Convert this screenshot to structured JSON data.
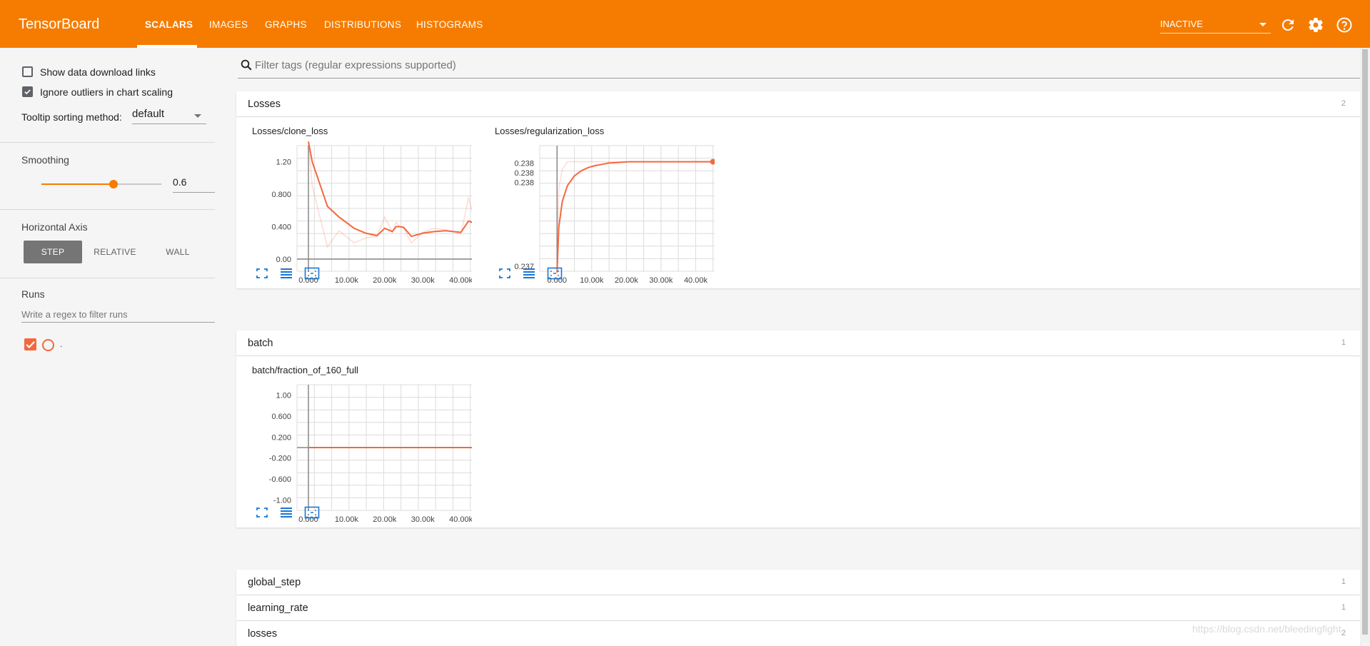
{
  "header": {
    "brand": "TensorBoard",
    "tabs": [
      "SCALARS",
      "IMAGES",
      "GRAPHS",
      "DISTRIBUTIONS",
      "HISTOGRAMS"
    ],
    "active_tab": "SCALARS",
    "run_status": "INACTIVE",
    "icons": [
      "refresh-icon",
      "settings-icon",
      "help-icon"
    ]
  },
  "sidebar": {
    "show_download_label": "Show data download links",
    "show_download_checked": false,
    "ignore_outliers_label": "Ignore outliers in chart scaling",
    "ignore_outliers_checked": true,
    "tooltip_label": "Tooltip sorting method:",
    "tooltip_value": "default",
    "smoothing_label": "Smoothing",
    "smoothing_value": "0.6",
    "smoothing_fraction": 0.6,
    "axis_label": "Horizontal Axis",
    "axis_options": [
      "STEP",
      "RELATIVE",
      "WALL"
    ],
    "axis_selected": "STEP",
    "runs_label": "Runs",
    "runs_filter_placeholder": "Write a regex to filter runs",
    "run_name": "."
  },
  "main": {
    "filter_placeholder": "Filter tags (regular expressions supported)",
    "categories": [
      {
        "name": "Losses",
        "count": "2"
      },
      {
        "name": "batch",
        "count": "1"
      },
      {
        "name": "global_step",
        "count": "1"
      },
      {
        "name": "learning_rate",
        "count": "1"
      },
      {
        "name": "losses",
        "count": "2"
      }
    ],
    "watermark": "https://blog.csdn.net/bleedingfight"
  },
  "colors": {
    "accent": "#f57c00",
    "series": "#f4683e"
  },
  "chart_data": [
    {
      "type": "line",
      "title": "Losses/clone_loss",
      "x": [
        0,
        1000,
        5000,
        8000,
        12000,
        15000,
        18000,
        20000,
        22000,
        23000,
        24000,
        25000,
        27000,
        30000,
        33000,
        36000,
        40000,
        42000,
        44000
      ],
      "series": [
        {
          "values": [
            1.45,
            1.2,
            0.65,
            0.52,
            0.38,
            0.32,
            0.29,
            0.38,
            0.34,
            0.4,
            0.4,
            0.39,
            0.28,
            0.32,
            0.34,
            0.35,
            0.33,
            0.47,
            0.43
          ]
        }
      ],
      "raw_values": [
        1.45,
        0.9,
        0.15,
        0.35,
        0.2,
        0.26,
        0.28,
        0.52,
        0.33,
        0.45,
        0.4,
        0.38,
        0.2,
        0.33,
        0.38,
        0.36,
        0.31,
        0.76,
        0.4
      ],
      "xticks": [
        "0.000",
        "10.00k",
        "20.00k",
        "30.00k",
        "40.00k"
      ],
      "yticks": [
        "1.20",
        "0.800",
        "0.400",
        "0.00"
      ],
      "xlim": [
        -3000,
        47000
      ],
      "ylim": [
        -0.15,
        1.4
      ]
    },
    {
      "type": "line",
      "title": "Losses/regularization_loss",
      "x": [
        0,
        500,
        1500,
        3000,
        5000,
        7000,
        9000,
        11000,
        13000,
        15000,
        18000,
        21000,
        25000,
        30000,
        35000,
        40000,
        45000
      ],
      "series": [
        {
          "values": [
            0.2365,
            0.2372,
            0.2376,
            0.23785,
            0.238,
            0.23808,
            0.23813,
            0.23816,
            0.23818,
            0.2382,
            0.23821,
            0.23822,
            0.23822,
            0.23822,
            0.23822,
            0.23822,
            0.23822
          ]
        }
      ],
      "raw_values": [
        0.2365,
        0.2378,
        0.2381,
        0.23822,
        0.23822,
        0.23822,
        0.23822,
        0.23822,
        0.23822,
        0.23822,
        0.23822,
        0.23822,
        0.23822,
        0.23822,
        0.23822,
        0.23822,
        0.23822
      ],
      "xticks": [
        "0.000",
        "10.00k",
        "20.00k",
        "30.00k",
        "40.00k"
      ],
      "yticks": [
        "0.238",
        "0.238",
        "0.238",
        "0.237"
      ],
      "xlim": [
        -5000,
        50000
      ],
      "ylim": [
        0.23652,
        0.23847
      ]
    },
    {
      "type": "line",
      "title": "batch/fraction_of_160_full",
      "x": [
        0,
        45000
      ],
      "series": [
        {
          "values": [
            0,
            0
          ]
        }
      ],
      "xticks": [
        "0.000",
        "10.00k",
        "20.00k",
        "30.00k",
        "40.00k"
      ],
      "yticks": [
        "1.00",
        "0.600",
        "0.200",
        "-0.200",
        "-0.600",
        "-1.00"
      ],
      "xlim": [
        -3000,
        47000
      ],
      "ylim": [
        -1.2,
        1.2
      ]
    }
  ]
}
